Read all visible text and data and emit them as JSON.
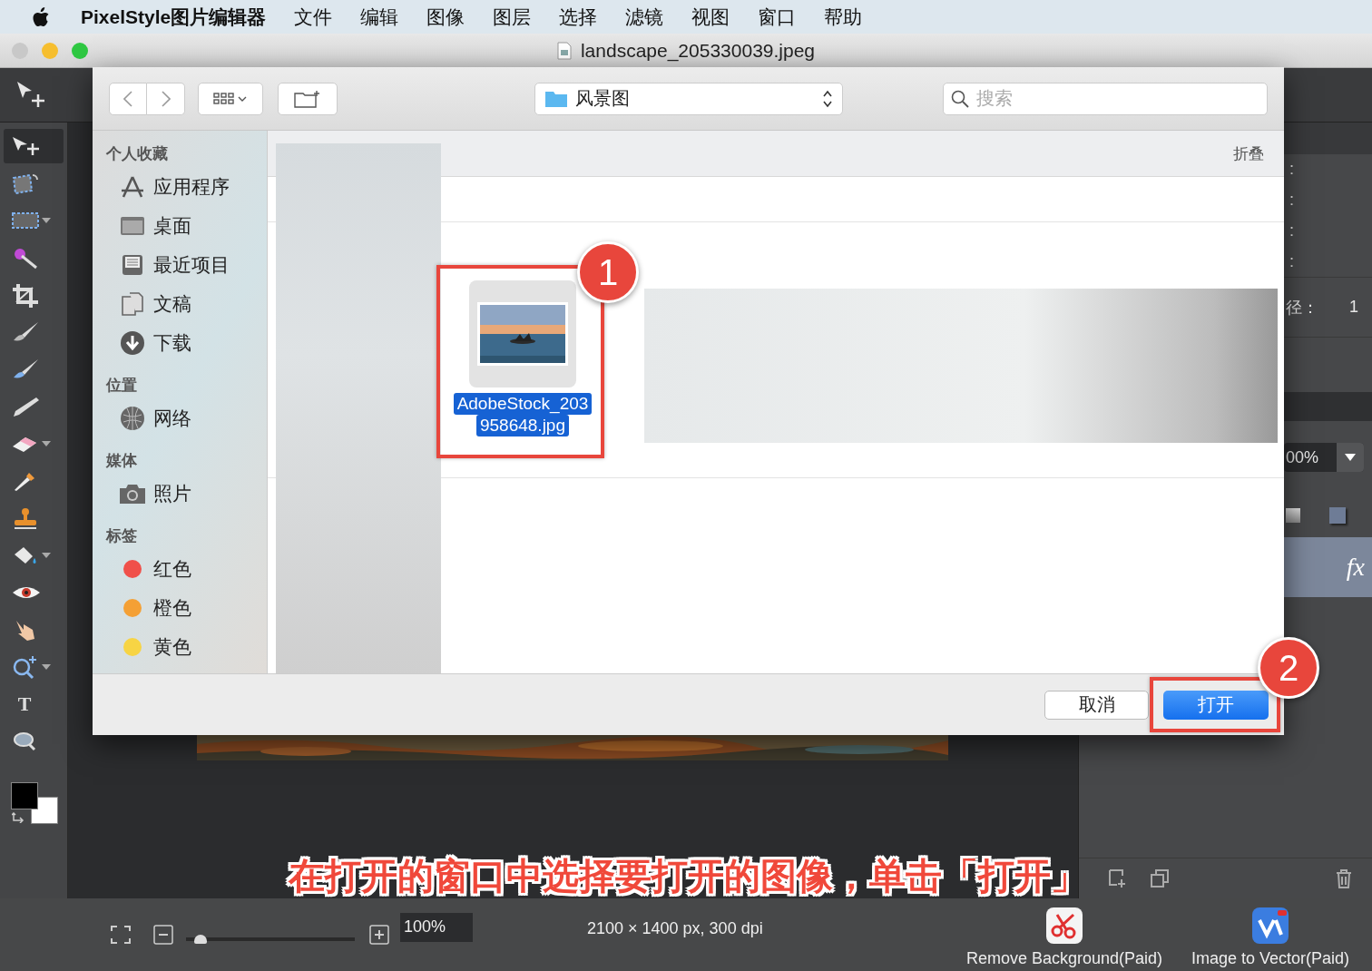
{
  "menu_bar": {
    "app_name": "PixelStyle图片编辑器",
    "items": [
      "文件",
      "编辑",
      "图像",
      "图层",
      "选择",
      "滤镜",
      "视图",
      "窗口",
      "帮助"
    ]
  },
  "window": {
    "title": "landscape_205330039.jpeg"
  },
  "tools": [
    {
      "kind": "move",
      "selected": true,
      "has_menu": false
    },
    {
      "kind": "transform",
      "selected": false,
      "has_menu": false
    },
    {
      "kind": "marquee",
      "selected": false,
      "has_menu": true
    },
    {
      "kind": "wand",
      "selected": false,
      "has_menu": false
    },
    {
      "kind": "crop",
      "selected": false,
      "has_menu": false
    },
    {
      "kind": "brush",
      "selected": false,
      "has_menu": false
    },
    {
      "kind": "smudge",
      "selected": false,
      "has_menu": false
    },
    {
      "kind": "pencil",
      "selected": false,
      "has_menu": false
    },
    {
      "kind": "eraser",
      "selected": false,
      "has_menu": true
    },
    {
      "kind": "dropper",
      "selected": false,
      "has_menu": false
    },
    {
      "kind": "stamp",
      "selected": false,
      "has_menu": false
    },
    {
      "kind": "bucket",
      "selected": false,
      "has_menu": true
    },
    {
      "kind": "eye",
      "selected": false,
      "has_menu": false
    },
    {
      "kind": "hand",
      "selected": false,
      "has_menu": false
    },
    {
      "kind": "zoom",
      "selected": false,
      "has_menu": true
    },
    {
      "kind": "type",
      "selected": false,
      "has_menu": false,
      "glyph": "T"
    },
    {
      "kind": "view",
      "selected": false,
      "has_menu": false
    }
  ],
  "open_dialog": {
    "location": "风景图",
    "search": {
      "placeholder": "搜索"
    },
    "sidebar": [
      {
        "heading": "个人收藏",
        "items": [
          {
            "label": "应用程序",
            "kind": "apps"
          },
          {
            "label": "桌面",
            "kind": "desktop"
          },
          {
            "label": "最近项目",
            "kind": "recents"
          },
          {
            "label": "文稿",
            "kind": "documents"
          },
          {
            "label": "下载",
            "kind": "downloads"
          }
        ]
      },
      {
        "heading": "位置",
        "items": [
          {
            "label": "网络",
            "kind": "network"
          }
        ]
      },
      {
        "heading": "媒体",
        "items": [
          {
            "label": "照片",
            "kind": "photos"
          }
        ]
      },
      {
        "heading": "标签",
        "items": [
          {
            "label": "红色",
            "kind": "tag",
            "color": "#f0504a"
          },
          {
            "label": "橙色",
            "kind": "tag",
            "color": "#f4a035"
          },
          {
            "label": "黄色",
            "kind": "tag",
            "color": "#f7d444"
          }
        ]
      }
    ],
    "collapse": "折叠",
    "files": [
      {
        "name_lines": [
          "AdobeStock_203",
          "958648.jpg"
        ],
        "selected": true
      }
    ],
    "cancel_button": "取消",
    "open_button": "打开"
  },
  "annotations": [
    {
      "number": "1"
    },
    {
      "number": "2"
    }
  ],
  "caption": "在打开的窗口中选择要打开的图像，单击「打开」",
  "right_panel": {
    "fields": [
      ":",
      ":",
      ":",
      ":"
    ],
    "radius_label": "径：",
    "radius_value": "1",
    "opacity": "00%",
    "layer_effects": "fx"
  },
  "status_bar": {
    "zoom": {
      "level": 0.05,
      "value": "100%"
    },
    "info": "2100 × 1400 px, 300 dpi",
    "plugins": [
      {
        "label": "Remove Background(Paid)",
        "kind": "scissors"
      },
      {
        "label": "Image to Vector(Paid)",
        "kind": "vector"
      }
    ]
  }
}
